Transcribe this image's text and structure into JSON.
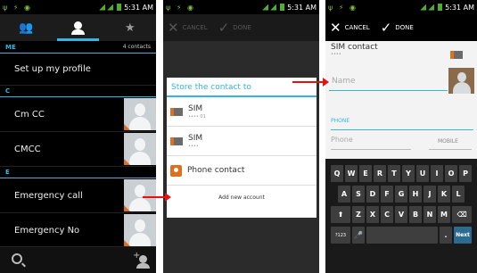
{
  "status_time": "5:31 AM",
  "panel1": {
    "tabs": [
      "groups-icon",
      "person-icon",
      "star-icon"
    ],
    "sections": [
      {
        "label": "ME",
        "count": "4 contacts"
      },
      {
        "label": "C"
      },
      {
        "label": "E"
      }
    ],
    "profile": "Set up my profile",
    "contacts": [
      "Cm CC",
      "CMCC",
      "Emergency call",
      "Emergency No"
    ]
  },
  "panel2": {
    "actions": {
      "cancel": "CANCEL",
      "done": "DONE"
    },
    "dialog": {
      "title": "Store the contact to",
      "options": [
        {
          "label": "SIM",
          "sub": "•••• 01"
        },
        {
          "label": "SIM",
          "sub": "••••"
        },
        {
          "label": "Phone contact"
        }
      ],
      "add_account": "Add new account"
    }
  },
  "panel3": {
    "actions": {
      "cancel": "CANCEL",
      "done": "DONE"
    },
    "account": {
      "label": "SIM contact",
      "sub": "••••"
    },
    "name_placeholder": "Name",
    "phone_section": "PHONE",
    "phone_placeholder": "Phone",
    "phone_type": "MOBILE",
    "keyboard": {
      "row1": [
        "Q",
        "W",
        "E",
        "R",
        "T",
        "Y",
        "U",
        "I",
        "O",
        "P"
      ],
      "row2": [
        "A",
        "S",
        "D",
        "F",
        "G",
        "H",
        "J",
        "K",
        "L"
      ],
      "row3": [
        "Z",
        "X",
        "C",
        "V",
        "B",
        "N",
        "M"
      ],
      "symbols": "?123",
      "next": "Next"
    }
  },
  "colors": {
    "accent": "#33b5e5",
    "arrow": "#e81010",
    "sim_orange": "#e07020"
  }
}
